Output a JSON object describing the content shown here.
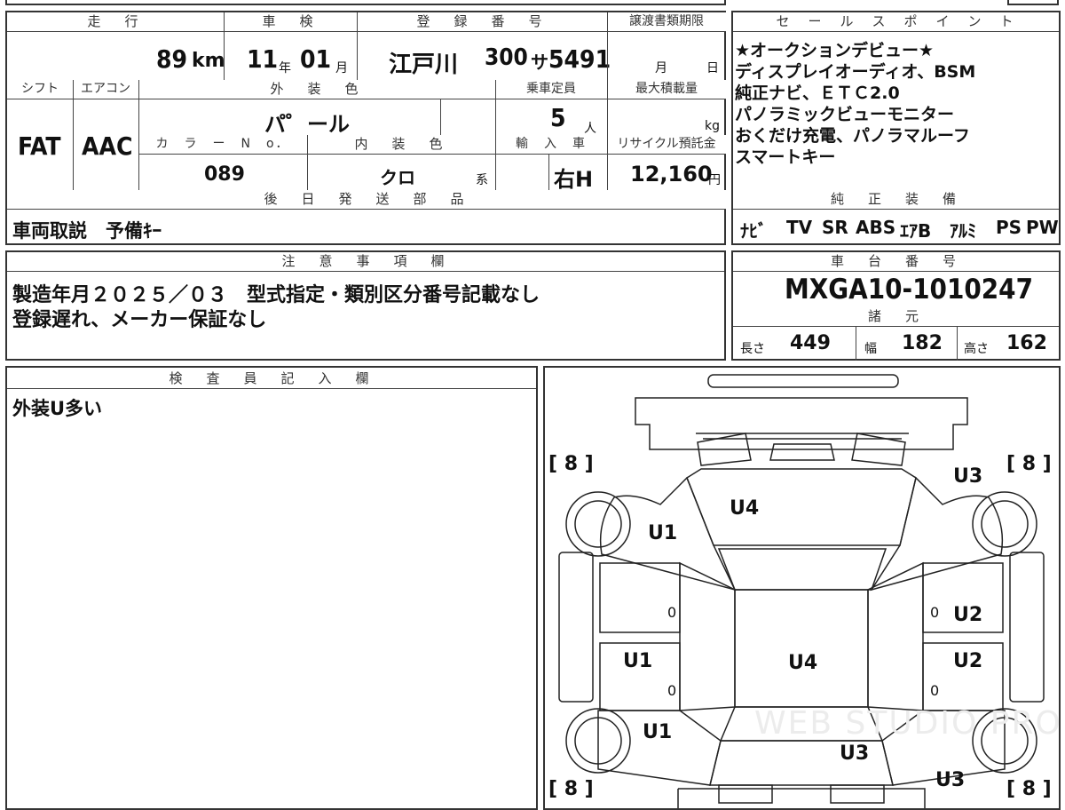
{
  "top_info": {
    "headers": {
      "mileage": "走　行",
      "inspection": "車　検",
      "registration": "登　録　番　号",
      "transfer_deadline": "譲渡書類期限",
      "shift": "シフト",
      "aircon": "エアコン",
      "exterior_color": "外　装　色",
      "capacity": "乗車定員",
      "max_load": "最大積載量",
      "color_no": "カ　ラ　ー　N　o．",
      "interior_color": "内　装　色",
      "import": "輸　入　車",
      "recycle": "リサイクル預託金",
      "later_parts": "後　日　発　送　部　品"
    },
    "mileage_value": "89",
    "mileage_unit": "km",
    "inspection_year": "11",
    "inspection_year_unit": "年",
    "inspection_month": "01",
    "inspection_month_unit": "月",
    "registration_area": "江戸川",
    "registration_class": "300",
    "registration_kana": "サ",
    "registration_number": "5491",
    "deadline_month_unit": "月",
    "deadline_day_unit": "日",
    "shift_value": "FAT",
    "aircon_value": "AAC",
    "exterior_color_value": "パ゜ール",
    "capacity_value": "5",
    "capacity_unit": "人",
    "max_load_unit": "kg",
    "color_no_value": "089",
    "interior_color_value": "クロ",
    "interior_color_suffix": "系",
    "import_value": "右H",
    "recycle_value": "12,160",
    "recycle_unit": "円",
    "later_parts_value": "車両取説　予備ｷｰ"
  },
  "sales_points": {
    "header": "セ　ー　ル　ス　ポ　イ　ン　ト",
    "lines": [
      "★オークションデビュー★",
      "ディスプレイオーディオ、BSM",
      "純正ナビ、ＥＴＣ2.0",
      "パノラミックビューモニター",
      "おくだけ充電、パノラマルーフ",
      "スマートキー"
    ]
  },
  "equipment": {
    "header": "純　正　装　備",
    "items": [
      "ﾅﾋﾞ",
      "TV",
      "SR",
      "ABS",
      "ｴｱB",
      "ｱﾙﾐ",
      "PS",
      "PW"
    ]
  },
  "notes": {
    "header": "注　意　事　項　欄",
    "lines": [
      "製造年月２０２５／０３　型式指定・類別区分番号記載なし",
      "登録遅れ、メーカー保証なし"
    ]
  },
  "chassis": {
    "header": "車　台　番　号",
    "value": "MXGA10-1010247"
  },
  "specs": {
    "header": "諸　元",
    "length_label": "長さ",
    "length_value": "449",
    "width_label": "幅",
    "width_value": "182",
    "height_label": "高さ",
    "height_value": "162"
  },
  "inspector": {
    "header": "検　査　員　記　入　欄",
    "text": "外装U多い"
  },
  "diagram": {
    "tire_left_top": "[ 8 ]",
    "tire_right_top": "[ 8 ]",
    "tire_left_bottom": "[ 8 ]",
    "tire_right_bottom": "[ 8 ]",
    "marks": {
      "hood": "U4",
      "front_left_fender": "U1",
      "front_right_fender": "U3",
      "roof": "U4",
      "left_front_door": "U1",
      "left_rear_door": "U1",
      "right_front_door": "U2",
      "right_rear_door": "U2",
      "trunk": "U3",
      "rear_right": "U3",
      "zero_left_front": "0",
      "zero_left_rear": "0",
      "zero_right_front": "0",
      "zero_right_rear": "0"
    },
    "watermark": "WEB STUDIO PRO"
  }
}
